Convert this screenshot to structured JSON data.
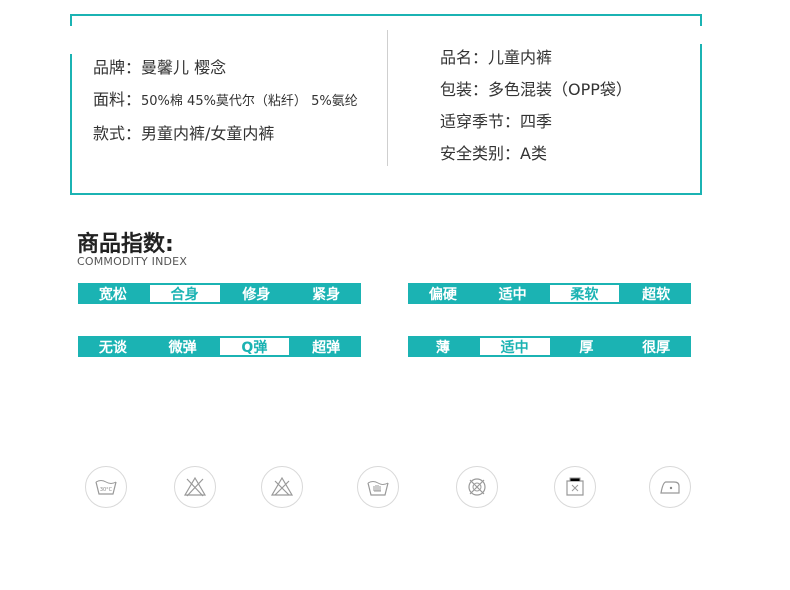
{
  "spec": {
    "left": [
      {
        "label": "品牌：",
        "value": "曼馨儿  樱念"
      },
      {
        "label": "面料：",
        "value": "50%棉  45%莫代尔（粘纤）  5%氨纶"
      },
      {
        "label": "款式：",
        "value": "男童内裤/女童内裤"
      }
    ],
    "right": [
      {
        "label": "品名：",
        "value": "儿童内裤"
      },
      {
        "label": "包装：",
        "value": "多色混装（OPP袋）"
      },
      {
        "label": "适穿季节：",
        "value": "四季"
      },
      {
        "label": "安全类别：",
        "value": "A类"
      }
    ]
  },
  "index": {
    "title": "商品指数:",
    "subtitle": "COMMODITY INDEX",
    "bars": [
      {
        "name": "fit",
        "options": [
          "宽松",
          "合身",
          "修身",
          "紧身"
        ],
        "selected": 1
      },
      {
        "name": "hardness",
        "options": [
          "偏硬",
          "适中",
          "柔软",
          "超软"
        ],
        "selected": 2
      },
      {
        "name": "elasticity",
        "options": [
          "无谈",
          "微弹",
          "Q弹",
          "超弹"
        ],
        "selected": 2
      },
      {
        "name": "thickness",
        "options": [
          "薄",
          "适中",
          "厚",
          "很厚"
        ],
        "selected": 1
      }
    ]
  },
  "care_icons": [
    "wash-30-icon",
    "no-bleach-icon",
    "no-chlorine-icon",
    "hand-wash-icon",
    "no-tumble-dry-icon",
    "hang-dry-icon",
    "iron-low-icon"
  ],
  "colors": {
    "accent": "#1bb3b3"
  }
}
